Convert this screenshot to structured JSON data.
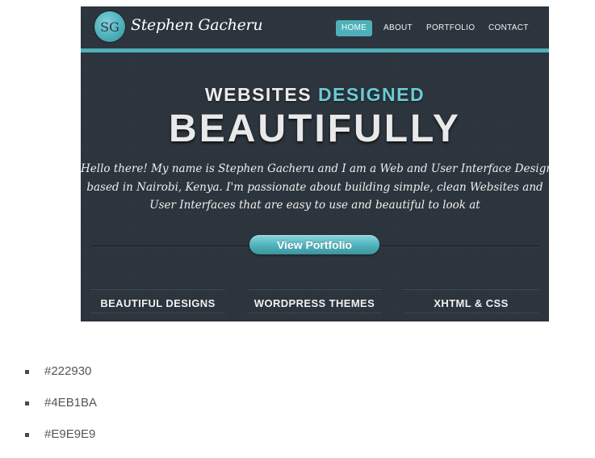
{
  "site": {
    "logo_initials": "SG",
    "logo_name": "Stephen Gacheru",
    "nav": [
      "HOME",
      "ABOUT",
      "PORTFOLIO",
      "CONTACT"
    ],
    "active_nav": "HOME",
    "headline_part1": "WEBSITES",
    "headline_part2": "DESIGNED",
    "headline_big": "BEAUTIFULLY",
    "intro_lines": [
      "Hello there! My name is Stephen Gacheru and I am a Web and User Interface Designer",
      "based in Nairobi, Kenya. I'm passionate about building simple, clean Websites and",
      "User Interfaces that are easy to use and beautiful to look at"
    ],
    "cta_label": "View Portfolio",
    "features": [
      "BEAUTIFUL DESIGNS",
      "WORDPRESS THEMES",
      "XHTML & CSS"
    ]
  },
  "colors": {
    "items": [
      "#222930",
      "#4EB1BA",
      "#E9E9E9"
    ]
  }
}
